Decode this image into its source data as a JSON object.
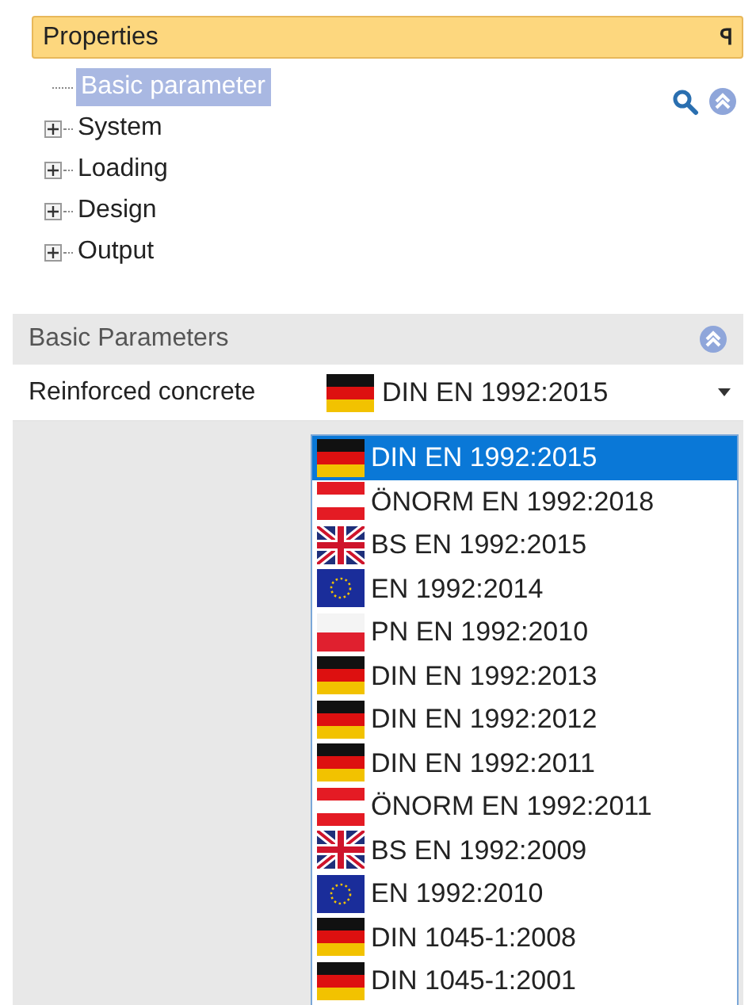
{
  "panel": {
    "title": "Properties",
    "pin": "ꟼ"
  },
  "tree": [
    {
      "label": "Basic parameter",
      "kind": "leaf",
      "selected": true
    },
    {
      "label": "System",
      "kind": "group",
      "expanded": false,
      "selected": false
    },
    {
      "label": "Loading",
      "kind": "group",
      "expanded": false,
      "selected": false
    },
    {
      "label": "Design",
      "kind": "group",
      "expanded": false,
      "selected": false
    },
    {
      "label": "Output",
      "kind": "group",
      "expanded": false,
      "selected": false
    }
  ],
  "section": {
    "title": "Basic Parameters",
    "expanded": true
  },
  "property": {
    "label": "Reinforced concrete",
    "value": {
      "label": "DIN EN 1992:2015",
      "kind": "de"
    }
  },
  "dropdown": [
    {
      "label": "DIN EN 1992:2015",
      "kind": "de",
      "selected": true
    },
    {
      "label": "ÖNORM EN 1992:2018",
      "kind": "at",
      "selected": false
    },
    {
      "label": "BS EN 1992:2015",
      "kind": "gb",
      "selected": false
    },
    {
      "label": "EN 1992:2014",
      "kind": "eu",
      "selected": false
    },
    {
      "label": "PN EN 1992:2010",
      "kind": "pl",
      "selected": false
    },
    {
      "label": "DIN EN 1992:2013",
      "kind": "de",
      "selected": false
    },
    {
      "label": "DIN EN 1992:2012",
      "kind": "de",
      "selected": false
    },
    {
      "label": "DIN EN 1992:2011",
      "kind": "de",
      "selected": false
    },
    {
      "label": "ÖNORM EN 1992:2011",
      "kind": "at",
      "selected": false
    },
    {
      "label": "BS EN 1992:2009",
      "kind": "gb",
      "selected": false
    },
    {
      "label": "EN 1992:2010",
      "kind": "eu",
      "selected": false
    },
    {
      "label": "DIN 1045-1:2008",
      "kind": "de",
      "selected": false
    },
    {
      "label": "DIN 1045-1:2001",
      "kind": "de",
      "selected": false
    }
  ]
}
